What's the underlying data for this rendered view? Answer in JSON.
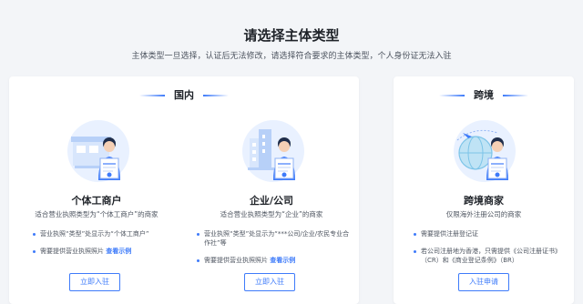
{
  "header": {
    "title": "请选择主体类型",
    "subtitle": "主体类型一旦选择，认证后无法修改，请选择符合要求的主体类型，个人身份证无法入驻"
  },
  "domestic": {
    "section_title": "国内",
    "individual": {
      "icon": "shop-storefront-icon",
      "title": "个体工商户",
      "desc": "适合营业执照类型为“个体工商户”的商家",
      "bullet1": "营业执照“类型”处显示为“个体工商户”",
      "bullet2_text": "需要提供营业执照照片",
      "bullet2_link": "查看示例",
      "button": "立即入驻"
    },
    "company": {
      "icon": "office-building-icon",
      "title": "企业/公司",
      "desc": "适合营业执照类型为“企业”的商家",
      "bullet1": "营业执照“类型”处显示为“***公司/企业/农民专业合作社”等",
      "bullet2_text": "需要提供营业执照照片",
      "bullet2_link": "查看示例",
      "button": "立即入驻"
    }
  },
  "crossborder": {
    "section_title": "跨境",
    "merchant": {
      "icon": "globe-airplane-icon",
      "title": "跨境商家",
      "desc": "仅限海外注册公司的商家",
      "bullet1": "需要提供注册登记证",
      "bullet2": "若公司注册地为香港，只需提供《公司注册证书》（CR）和《商业登记条例》（BR）",
      "button": "入驻申请"
    }
  },
  "colors": {
    "accent": "#3e7bfa",
    "background": "#f3f5f8",
    "card": "#ffffff"
  }
}
